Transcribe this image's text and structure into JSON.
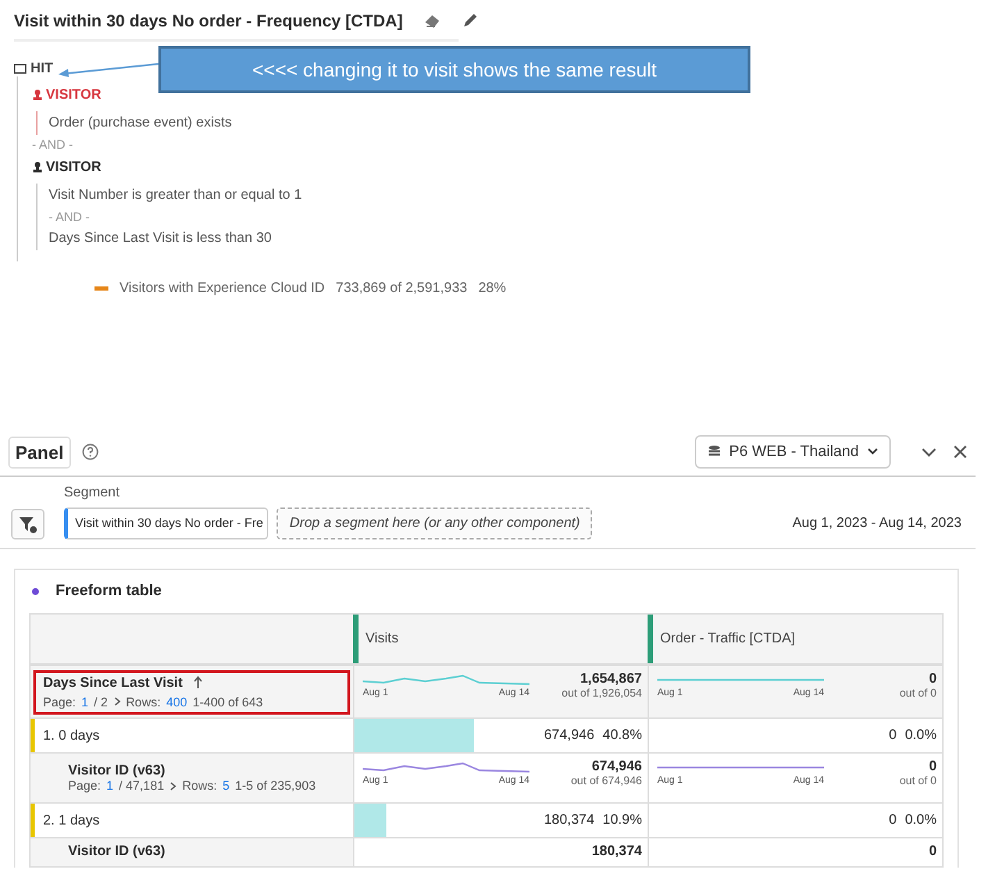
{
  "segment_definition": {
    "title": "Visit within 30 days No order - Frequency [CTDA]",
    "container": {
      "label": "HIT",
      "items": [
        {
          "kind": "container",
          "label": "VISITOR",
          "color": "#d7373f",
          "items": [
            {
              "kind": "rule",
              "text": "Order (purchase event) exists"
            }
          ]
        },
        {
          "kind": "operator",
          "text": "- AND -"
        },
        {
          "kind": "container",
          "label": "VISITOR",
          "color": "#2c2c2c",
          "items": [
            {
              "kind": "rule",
              "text": "Visit Number is greater than or equal to 1"
            },
            {
              "kind": "operator",
              "text": "- AND -"
            },
            {
              "kind": "rule",
              "text": "Days Since Last Visit is less than 30"
            }
          ]
        }
      ]
    },
    "legend": {
      "text": "Visitors with Experience Cloud ID",
      "value": "733,869 of 2,591,933",
      "percent": "28%"
    }
  },
  "annotation": {
    "text": "<<<< changing it to visit shows the same result"
  },
  "panel": {
    "title": "Panel",
    "report_suite": "P6 WEB - Thailand",
    "segment_label": "Segment",
    "segment": "Visit within 30 days No order - Fre",
    "drop_placeholder": "Drop a segment here (or any other component)",
    "date_range": "Aug 1, 2023 - Aug 14, 2023"
  },
  "table": {
    "title": "Freeform table",
    "columns": [
      "Visits",
      "Order - Traffic [CTDA]"
    ],
    "dimension": {
      "name": "Days Since Last Visit",
      "page_label": "Page:",
      "page": "1",
      "pages": "/ 2",
      "rows_label": "Rows:",
      "rows": "400",
      "range": "1-400 of 643"
    },
    "totals": [
      {
        "value": "1,654,867",
        "out_of": "out of 1,926,054",
        "start": "Aug 1",
        "end": "Aug 14"
      },
      {
        "value": "0",
        "out_of": "out of 0",
        "start": "Aug 1",
        "end": "Aug 14"
      }
    ],
    "rows": [
      {
        "kind": "item",
        "label": "1.  0 days",
        "cells": [
          {
            "value": "674,946",
            "percent": "40.8%",
            "level": 0.408
          },
          {
            "value": "0",
            "percent": "0.0%"
          }
        ]
      },
      {
        "kind": "breakdown",
        "name": "Visitor ID (v63)",
        "page_label": "Page:",
        "page": "1",
        "pages": "/ 47,181",
        "rows_label": "Rows:",
        "rows": "5",
        "range": "1-5 of 235,903",
        "cells": [
          {
            "value": "674,946",
            "out_of": "out of 674,946",
            "start": "Aug 1",
            "end": "Aug 14"
          },
          {
            "value": "0",
            "out_of": "out of 0",
            "start": "Aug 1",
            "end": "Aug 14"
          }
        ]
      },
      {
        "kind": "item",
        "label": "2.  1 days",
        "cells": [
          {
            "value": "180,374",
            "percent": "10.9%",
            "level": 0.109
          },
          {
            "value": "0",
            "percent": "0.0%"
          }
        ]
      },
      {
        "kind": "partial",
        "name": "Visitor ID (v63)",
        "cells": [
          {
            "value": "180,374"
          },
          {
            "value": "0"
          }
        ]
      }
    ]
  }
}
